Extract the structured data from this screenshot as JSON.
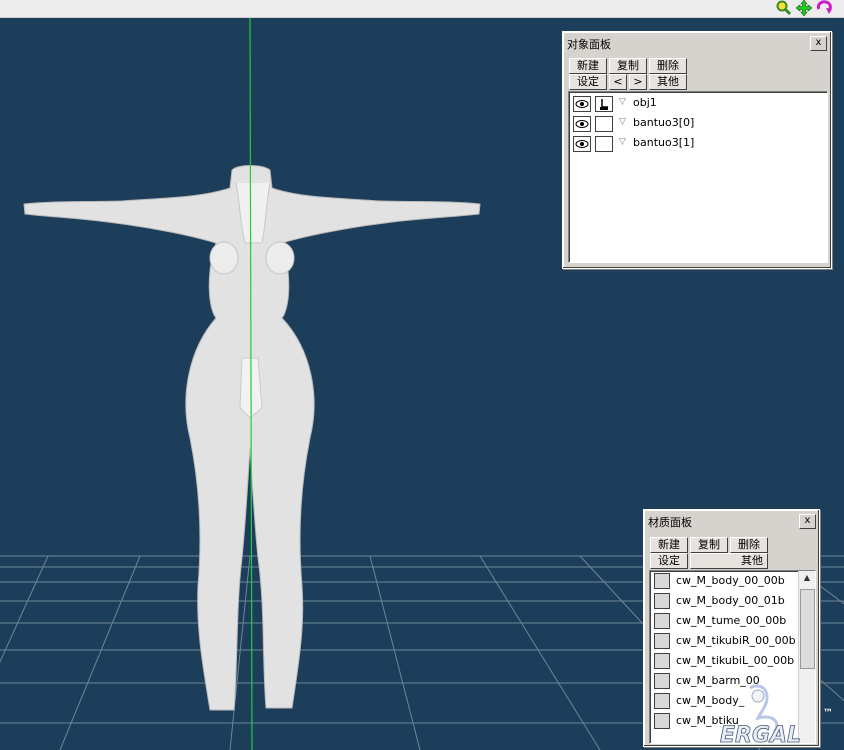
{
  "colors": {
    "viewport_bg": "#1d3e5a",
    "grid_line": "#6f8598",
    "axis_line": "#1ecf3a",
    "body": "#e4e4e4",
    "panel_bg": "#d6d3ce"
  },
  "toolbar": {
    "icons": [
      "zoom-icon",
      "pan-icon",
      "rotate-icon"
    ]
  },
  "object_panel": {
    "title": "对象面板",
    "close_label": "x",
    "buttons": {
      "new": "新建",
      "copy": "复制",
      "delete": "删除",
      "settings": "设定",
      "prev": "<",
      "next": ">",
      "other": "其他"
    },
    "objects": [
      {
        "name": "obj1",
        "visible": true,
        "locked": true
      },
      {
        "name": "bantuo3[0]",
        "visible": true,
        "locked": false
      },
      {
        "name": "bantuo3[1]",
        "visible": true,
        "locked": false
      }
    ]
  },
  "material_panel": {
    "title": "材质面板",
    "close_label": "x",
    "buttons": {
      "new": "新建",
      "copy": "复制",
      "delete": "删除",
      "settings": "设定",
      "other": "其他"
    },
    "materials": [
      "cw_M_body_00_00b",
      "cw_M_body_00_01b",
      "cw_M_tume_00_00b",
      "cw_M_tikubiR_00_00b",
      "cw_M_tikubiL_00_00b",
      "cw_M_barm_00",
      "cw_M_body_",
      "cw_M_btiku"
    ]
  },
  "watermark": {
    "text": "ERGAL",
    "tm": "™"
  }
}
